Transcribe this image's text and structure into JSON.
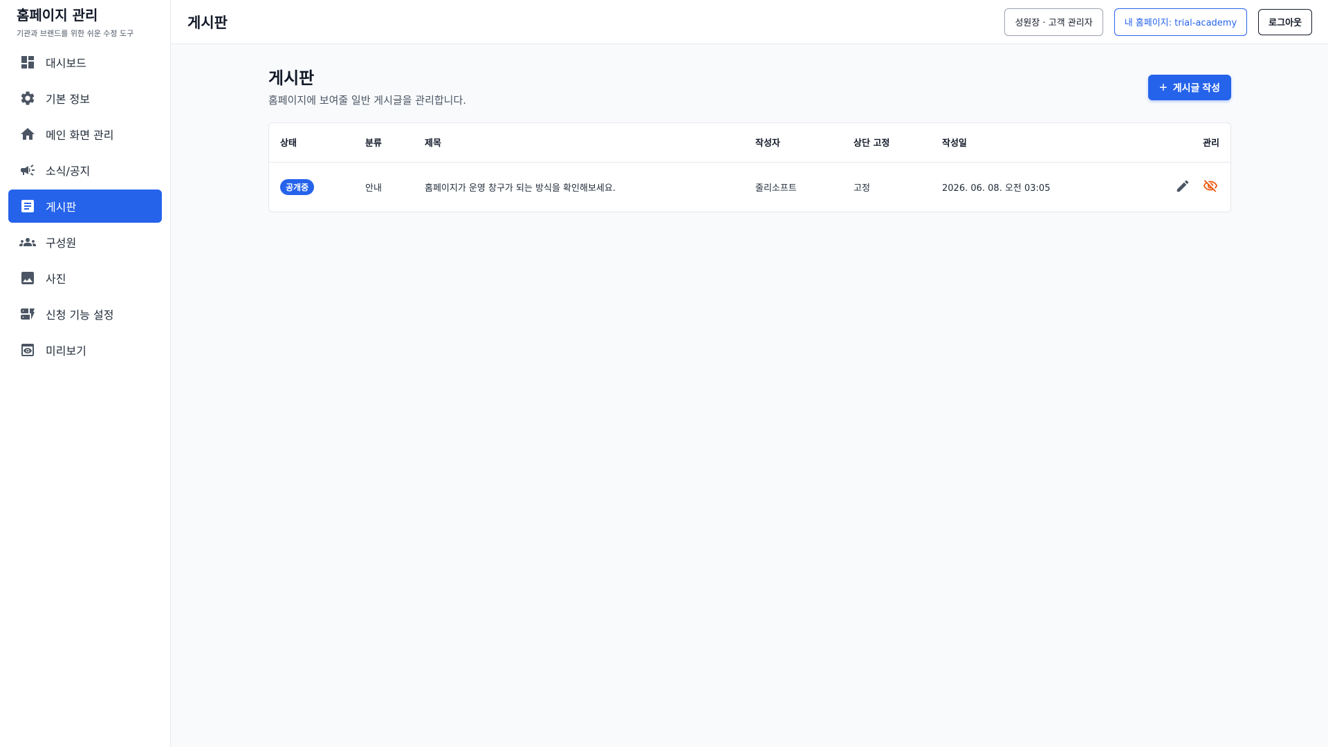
{
  "sidebar": {
    "brand_title": "홈페이지 관리",
    "brand_subtitle": "기관과 브랜드를 위한 쉬운 수정 도구",
    "items": [
      {
        "label": "대시보드",
        "icon": "dashboard-icon"
      },
      {
        "label": "기본 정보",
        "icon": "gear-icon"
      },
      {
        "label": "메인 화면 관리",
        "icon": "home-icon"
      },
      {
        "label": "소식/공지",
        "icon": "megaphone-icon"
      },
      {
        "label": "게시판",
        "icon": "article-icon",
        "active": true
      },
      {
        "label": "구성원",
        "icon": "group-icon"
      },
      {
        "label": "사진",
        "icon": "image-icon"
      },
      {
        "label": "신청 기능 설정",
        "icon": "dynamic-form-icon"
      },
      {
        "label": "미리보기",
        "icon": "preview-icon"
      }
    ]
  },
  "topbar": {
    "title": "게시판",
    "user_chip": "성원장 · 고객 관리자",
    "site_chip": "내 홈페이지: trial-academy",
    "logout_label": "로그아웃"
  },
  "page": {
    "title": "게시판",
    "description": "홈페이지에 보여줄 일반 게시글을 관리합니다.",
    "new_post_label": "게시글 작성"
  },
  "table": {
    "columns": [
      "상태",
      "분류",
      "제목",
      "작성자",
      "상단 고정",
      "작성일",
      "관리"
    ],
    "rows": [
      {
        "status": "공개중",
        "category": "안내",
        "title": "홈페이지가 운영 창구가 되는 방식을 확인해보세요.",
        "author": "줄리소프트",
        "pinned": "고정",
        "date": "2026. 06. 08. 오전 03:05"
      }
    ]
  },
  "colors": {
    "accent": "#2563eb",
    "hide_icon": "#ea580c",
    "edit_icon": "#4b5563"
  }
}
